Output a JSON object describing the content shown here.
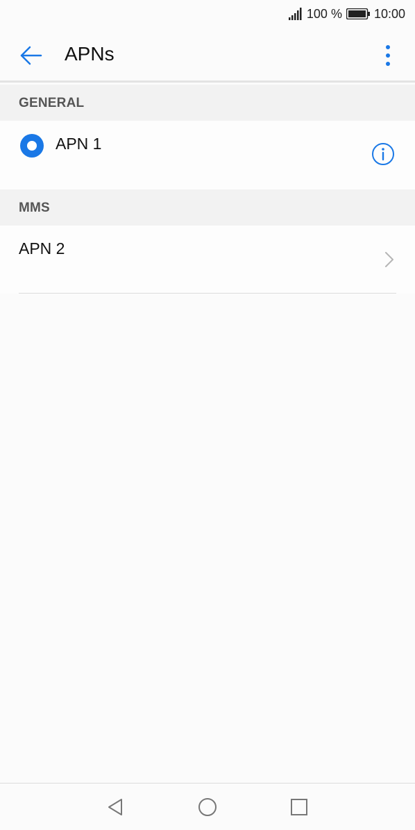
{
  "status_bar": {
    "battery_percent": "100 %",
    "time": "10:00",
    "icons": [
      "signal-icon",
      "battery-icon"
    ]
  },
  "app_bar": {
    "title": "APNs",
    "back_icon": "arrow-left-icon",
    "menu_icon": "more-vertical-icon"
  },
  "sections": [
    {
      "header": "GENERAL",
      "items": [
        {
          "label": "APN 1",
          "selected": true,
          "trailing_icon": "info-icon"
        }
      ]
    },
    {
      "header": "MMS",
      "items": [
        {
          "label": "APN 2",
          "trailing_icon": "chevron-right-icon"
        }
      ]
    }
  ],
  "nav_bar": {
    "icons": [
      "nav-back-icon",
      "nav-home-icon",
      "nav-recent-icon"
    ]
  },
  "colors": {
    "accent": "#1a78e6",
    "background": "#fbfbfb",
    "section_header_bg": "#f2f2f2"
  }
}
